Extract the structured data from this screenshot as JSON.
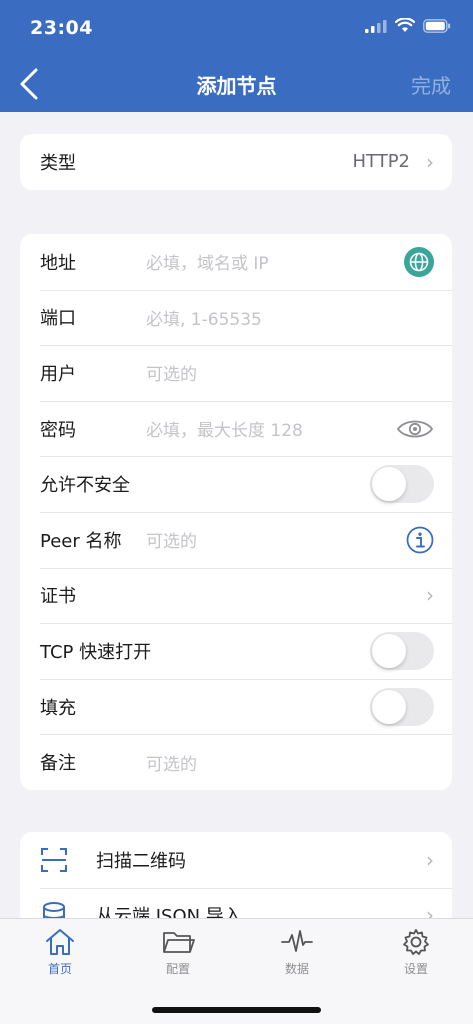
{
  "status_bar": {
    "time": "23:04"
  },
  "nav": {
    "title": "添加节点",
    "done_label": "完成"
  },
  "type_row": {
    "label": "类型",
    "value": "HTTP2"
  },
  "form": {
    "address": {
      "label": "地址",
      "placeholder": "必填，域名或 IP"
    },
    "port": {
      "label": "端口",
      "placeholder": "必填, 1-65535"
    },
    "user": {
      "label": "用户",
      "placeholder": "可选的"
    },
    "password": {
      "label": "密码",
      "placeholder": "必填，最大长度 128"
    },
    "allow_insecure": {
      "label": "允许不安全",
      "on": false
    },
    "peer_name": {
      "label": "Peer 名称",
      "placeholder": "可选的"
    },
    "certificate": {
      "label": "证书"
    },
    "tcp_fast_open": {
      "label": "TCP 快速打开",
      "on": false
    },
    "padding": {
      "label": "填充",
      "on": false
    },
    "remark": {
      "label": "备注",
      "placeholder": "可选的"
    }
  },
  "import_actions": {
    "scan_qr": {
      "label": "扫描二维码",
      "icon": "scan-qr-icon"
    },
    "cloud_json": {
      "label": "从云端 JSON 导入",
      "icon": "database-icon"
    }
  },
  "tabbar": {
    "tabs": [
      {
        "label": "首页",
        "icon": "home-icon",
        "active": true
      },
      {
        "label": "配置",
        "icon": "folder-icon",
        "active": false
      },
      {
        "label": "数据",
        "icon": "activity-icon",
        "active": false
      },
      {
        "label": "设置",
        "icon": "gear-icon",
        "active": false
      }
    ]
  },
  "colors": {
    "primary": "#3a6dc1",
    "accent_teal": "#3aa59a"
  }
}
